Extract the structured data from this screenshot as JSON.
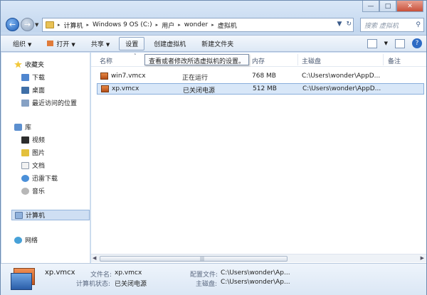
{
  "window": {
    "controls": [
      "—",
      "□",
      "✕"
    ]
  },
  "address": {
    "crumbs": [
      "计算机",
      "Windows 9 OS (C:)",
      "用户",
      "wonder",
      "虚拟机"
    ],
    "separator": "▸"
  },
  "search": {
    "placeholder": "搜索 虚拟机"
  },
  "toolbar": {
    "organize": "组织",
    "open": "打开",
    "share": "共享",
    "settings": "设置",
    "create_vm": "创建虚拟机",
    "new_folder": "新建文件夹"
  },
  "nav": {
    "favorites": "收藏夹",
    "downloads": "下载",
    "desktop": "桌面",
    "recent": "最近访问的位置",
    "libraries": "库",
    "videos": "视频",
    "pictures": "图片",
    "documents": "文档",
    "thunder": "迅雷下载",
    "music": "音乐",
    "computer": "计算机",
    "network": "网络"
  },
  "columns": {
    "name": "名称",
    "memory": "内存",
    "disk": "主磁盘",
    "notes": "备注"
  },
  "tooltip": "查看或者修改所选虚拟机的设置。",
  "rows": [
    {
      "name": "win7.vmcx",
      "status": "正在运行",
      "memory": "768 MB",
      "disk": "C:\\Users\\wonder\\AppD..."
    },
    {
      "name": "xp.vmcx",
      "status": "已关闭电源",
      "memory": "512 MB",
      "disk": "C:\\Users\\wonder\\AppD..."
    }
  ],
  "details": {
    "title": "xp.vmcx",
    "filename_label": "文件名:",
    "filename": "xp.vmcx",
    "state_label": "计算机状态:",
    "state": "已关闭电源",
    "config_label": "配置文件:",
    "config": "C:\\Users\\wonder\\Ap...",
    "disk_label": "主磁盘:",
    "disk": "C:\\Users\\wonder\\Ap..."
  }
}
